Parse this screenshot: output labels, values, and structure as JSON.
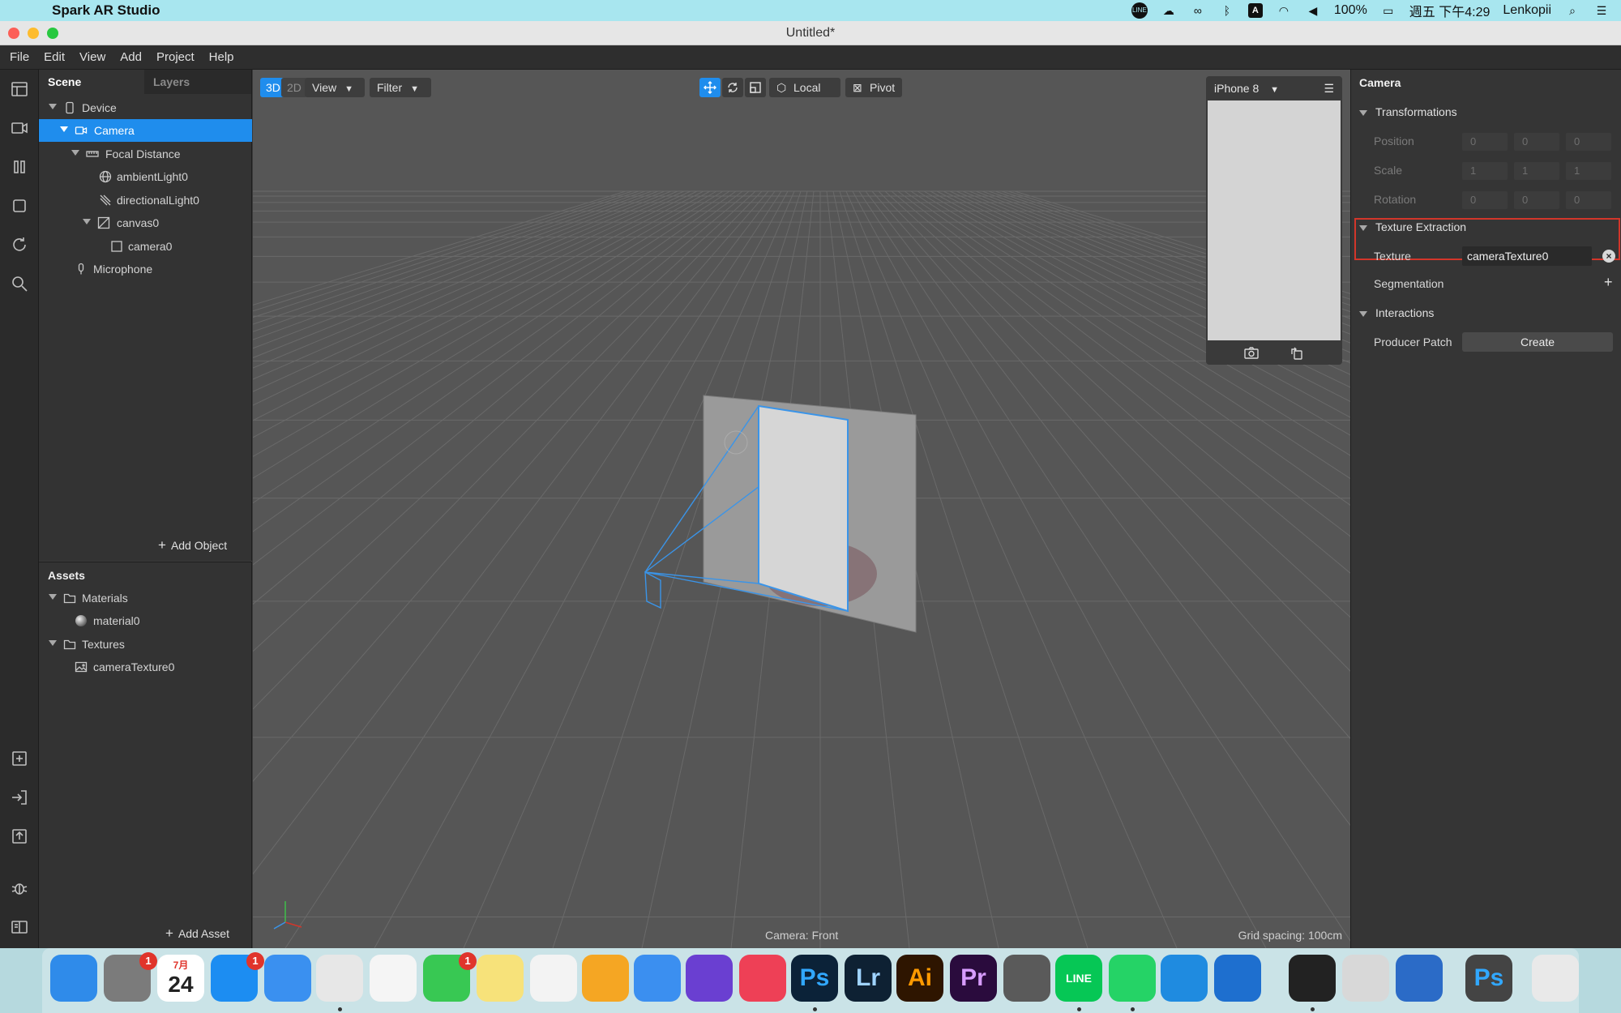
{
  "mac_menubar": {
    "app_name": "Spark AR Studio",
    "battery": "100%",
    "datetime": "週五 下午4:29",
    "user": "Lenkopii",
    "input_source": "A",
    "line_label": "LINE"
  },
  "window": {
    "title": "Untitled*"
  },
  "app_menu": [
    "File",
    "Edit",
    "View",
    "Add",
    "Project",
    "Help"
  ],
  "scene": {
    "tabs": [
      "Scene",
      "Layers"
    ],
    "items": [
      {
        "label": "Device",
        "icon": "device-icon"
      },
      {
        "label": "Camera",
        "icon": "camera-icon",
        "selected": true
      },
      {
        "label": "Focal Distance",
        "icon": "ruler-icon"
      },
      {
        "label": "ambientLight0",
        "icon": "globe-icon"
      },
      {
        "label": "directionalLight0",
        "icon": "directional-light-icon"
      },
      {
        "label": "canvas0",
        "icon": "canvas-icon"
      },
      {
        "label": "camera0",
        "icon": "rectangle-icon"
      },
      {
        "label": "Microphone",
        "icon": "microphone-icon"
      }
    ],
    "add_object": "Add Object"
  },
  "assets": {
    "title": "Assets",
    "items": [
      {
        "label": "Materials",
        "icon": "folder-icon"
      },
      {
        "label": "material0",
        "icon": "sphere-icon"
      },
      {
        "label": "Textures",
        "icon": "folder-icon"
      },
      {
        "label": "cameraTexture0",
        "icon": "image-icon"
      }
    ],
    "add_asset": "Add Asset"
  },
  "viewport": {
    "mode_3d": "3D",
    "mode_2d": "2D",
    "view_menu": "View",
    "filter_menu": "Filter",
    "local_label": "Local",
    "pivot_label": "Pivot",
    "device": "iPhone 8",
    "camera_status": "Camera: Front",
    "grid_spacing": "Grid spacing: 100cm"
  },
  "inspector": {
    "title": "Camera",
    "transformations": "Transformations",
    "position_label": "Position",
    "position": [
      "0",
      "0",
      "0"
    ],
    "scale_label": "Scale",
    "scale": [
      "1",
      "1",
      "1"
    ],
    "rotation_label": "Rotation",
    "rotation": [
      "0",
      "0",
      "0"
    ],
    "texture_extraction": "Texture Extraction",
    "texture_label": "Texture",
    "texture_value": "cameraTexture0",
    "segmentation": "Segmentation",
    "interactions": "Interactions",
    "producer_patch_label": "Producer Patch",
    "create_button": "Create"
  },
  "dock": {
    "items": [
      {
        "name": "finder-icon",
        "color": "#2f8bea"
      },
      {
        "name": "system-preferences-icon",
        "color": "#7b7b7b",
        "badge": "1"
      },
      {
        "name": "calendar-icon",
        "color": "#ffffff",
        "month": "7月",
        "day": "24"
      },
      {
        "name": "app-store-icon",
        "color": "#1c8df2",
        "badge": "1"
      },
      {
        "name": "safari-icon",
        "color": "#3a90f0"
      },
      {
        "name": "chrome-icon",
        "color": "#e7e7e7"
      },
      {
        "name": "photos-icon",
        "color": "#f5f5f5"
      },
      {
        "name": "facetime-icon",
        "color": "#38c853",
        "badge": "1"
      },
      {
        "name": "notes-icon",
        "color": "#f7e27a"
      },
      {
        "name": "reminders-icon",
        "color": "#f3f3f3"
      },
      {
        "name": "pages-icon",
        "color": "#f5a623"
      },
      {
        "name": "keynote-icon",
        "color": "#3b8ff0"
      },
      {
        "name": "imovie-icon",
        "color": "#6a3fd1"
      },
      {
        "name": "pocket-icon",
        "color": "#ee4056"
      },
      {
        "name": "photoshop-icon",
        "color": "#0b2238",
        "text": "Ps",
        "text_color": "#31a8ff"
      },
      {
        "name": "lightroom-icon",
        "color": "#0e2133",
        "text": "Lr",
        "text_color": "#9fd3ff"
      },
      {
        "name": "illustrator-icon",
        "color": "#2e1500",
        "text": "Ai",
        "text_color": "#ff9a00"
      },
      {
        "name": "premiere-icon",
        "color": "#2a0b3d",
        "text": "Pr",
        "text_color": "#d79cff"
      },
      {
        "name": "spark-ar-icon",
        "color": "#5a5a5a"
      },
      {
        "name": "line-icon",
        "color": "#06c755",
        "text": "LINE"
      },
      {
        "name": "whatsapp-icon",
        "color": "#25d366"
      },
      {
        "name": "vscode-icon",
        "color": "#1f8be0"
      },
      {
        "name": "vpn-icon",
        "color": "#1e6fcf"
      },
      {
        "name": "activity-monitor-icon",
        "color": "#222222"
      },
      {
        "name": "preview-icon",
        "color": "#d8d8d8"
      },
      {
        "name": "quicktime-icon",
        "color": "#2b6bc7"
      },
      {
        "name": "photoshop-window-icon",
        "color": "#444444",
        "text": "Ps",
        "text_color": "#31a8ff"
      },
      {
        "name": "trash-icon",
        "color": "#e9e9e9"
      }
    ]
  }
}
